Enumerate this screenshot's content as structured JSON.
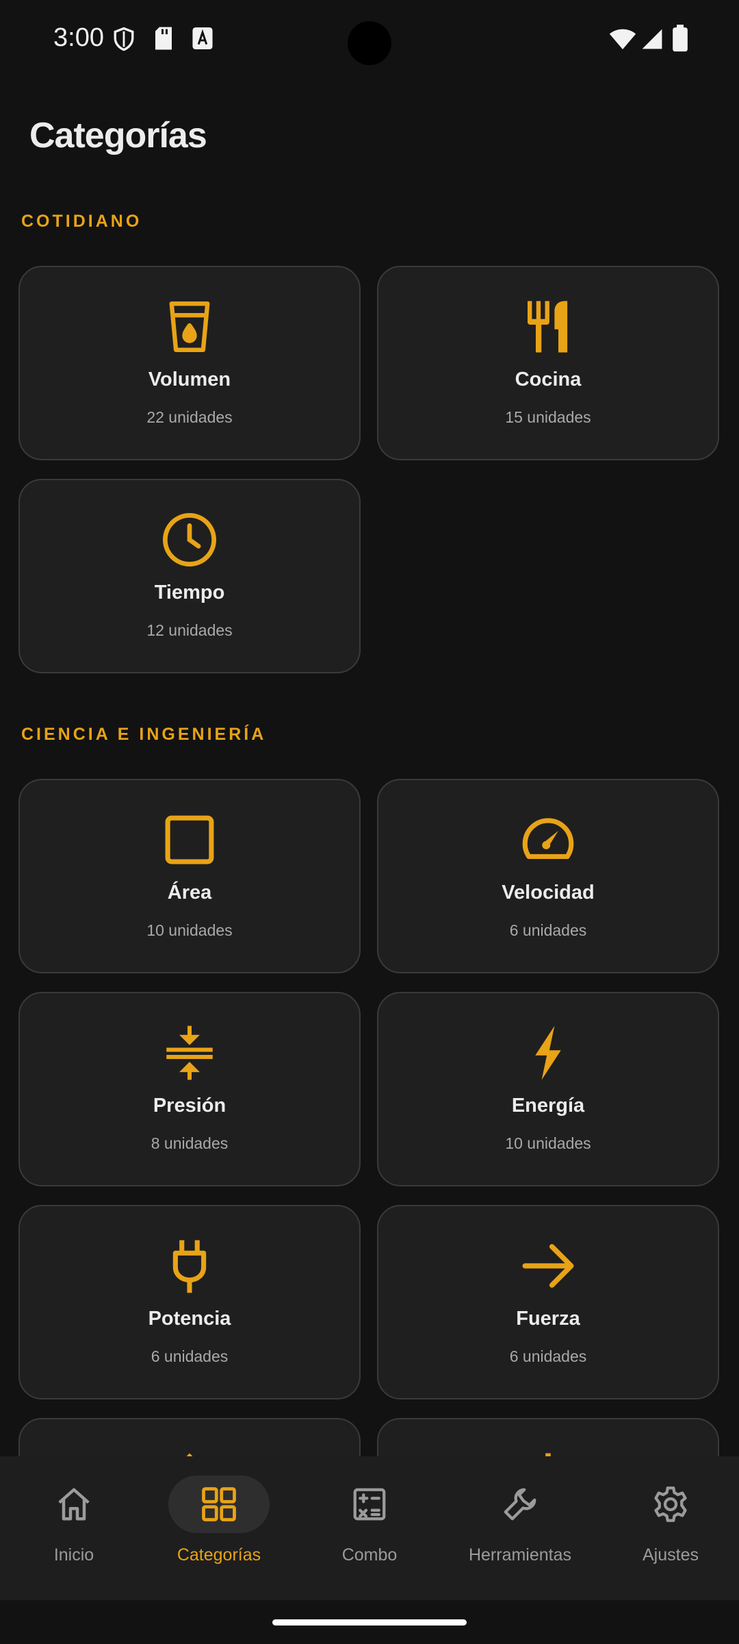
{
  "status": {
    "time": "3:00"
  },
  "page": {
    "title": "Categorías"
  },
  "colors": {
    "accent": "#e8a317",
    "background": "#121212",
    "card": "#1f1f1f"
  },
  "sections": [
    {
      "label": "COTIDIANO",
      "cards": [
        {
          "name": "Volumen",
          "count": "22 unidades",
          "icon": "cup-water-icon"
        },
        {
          "name": "Cocina",
          "count": "15 unidades",
          "icon": "fork-knife-icon"
        },
        {
          "name": "Tiempo",
          "count": "12 unidades",
          "icon": "clock-icon"
        }
      ]
    },
    {
      "label": "CIENCIA E INGENIERÍA",
      "cards": [
        {
          "name": "Área",
          "count": "10 unidades",
          "icon": "square-icon"
        },
        {
          "name": "Velocidad",
          "count": "6 unidades",
          "icon": "speedometer-icon"
        },
        {
          "name": "Presión",
          "count": "8 unidades",
          "icon": "compress-icon"
        },
        {
          "name": "Energía",
          "count": "10 unidades",
          "icon": "bolt-icon"
        },
        {
          "name": "Potencia",
          "count": "6 unidades",
          "icon": "plug-icon"
        },
        {
          "name": "Fuerza",
          "count": "6 unidades",
          "icon": "arrow-right-icon"
        }
      ]
    }
  ],
  "nav": [
    {
      "label": "Inicio",
      "icon": "home-icon"
    },
    {
      "label": "Categorías",
      "icon": "grid-icon",
      "active": true
    },
    {
      "label": "Combo",
      "icon": "calculator-icon"
    },
    {
      "label": "Herramientas",
      "icon": "wrench-icon"
    },
    {
      "label": "Ajustes",
      "icon": "gear-icon"
    }
  ]
}
